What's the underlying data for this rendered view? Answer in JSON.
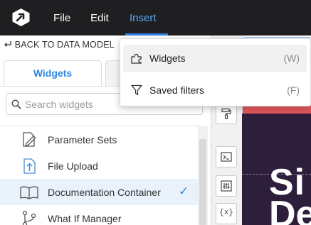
{
  "menubar": {
    "items": [
      {
        "label": "File"
      },
      {
        "label": "Edit"
      },
      {
        "label": "Insert"
      }
    ],
    "active": "Insert",
    "accent_color": "#2f7de1"
  },
  "panel": {
    "back_label": "BACK TO DATA MODEL",
    "tabs": [
      {
        "label": "Widgets",
        "selected": true
      },
      {
        "label": ""
      }
    ],
    "search": {
      "placeholder": "Search widgets",
      "value": ""
    },
    "items": [
      {
        "label": "Parameter Sets",
        "icon": "pencil-document-icon",
        "selected": false
      },
      {
        "label": "File Upload",
        "icon": "upload-icon",
        "selected": false
      },
      {
        "label": "Documentation Container",
        "icon": "book-icon",
        "selected": true
      },
      {
        "label": "What If Manager",
        "icon": "branch-icon",
        "selected": false
      }
    ]
  },
  "toolstrip": {
    "top_glyph": "×",
    "buttons": [
      {
        "icon": "paint-roller-icon"
      },
      {
        "icon": "terminal-icon"
      },
      {
        "icon": "sliders-icon"
      },
      {
        "icon": "variable-icon",
        "text": "{x}"
      }
    ]
  },
  "canvas": {
    "title_line_1": "Si",
    "title_line_2": "De"
  },
  "dropdown": {
    "items": [
      {
        "label": "Widgets",
        "shortcut": "(W)",
        "icon": "puzzle-icon",
        "hovered": true
      },
      {
        "label": "Saved filters",
        "shortcut": "(F)",
        "icon": "filter-icon",
        "hovered": false
      }
    ]
  }
}
